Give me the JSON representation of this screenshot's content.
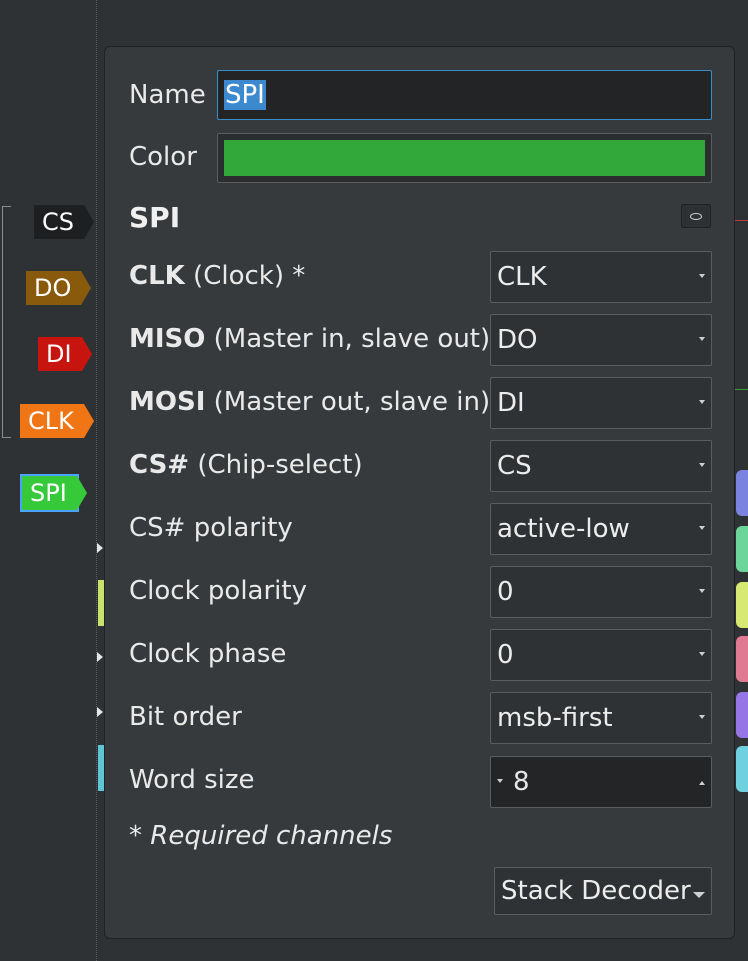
{
  "channels": [
    {
      "label": "CS",
      "color": "#1e1f20"
    },
    {
      "label": "DO",
      "color": "#8a5a0c"
    },
    {
      "label": "DI",
      "color": "#c8140e"
    },
    {
      "label": "CLK",
      "color": "#f07514"
    },
    {
      "label": "SPI",
      "color": "#36c93a"
    }
  ],
  "dialog": {
    "name_label": "Name",
    "name_value": "SPI",
    "color_label": "Color",
    "color_value": "#32a83a",
    "decoder_title": "SPI",
    "collapse_icon": "eye-icon",
    "options": [
      {
        "bold": "CLK",
        "rest": " (Clock) *",
        "value": "CLK"
      },
      {
        "bold": "MISO",
        "rest": " (Master in, slave out)",
        "value": "DO"
      },
      {
        "bold": "MOSI",
        "rest": " (Master out, slave in)",
        "value": "DI"
      },
      {
        "bold": "CS#",
        "rest": " (Chip-select)",
        "value": "CS"
      },
      {
        "bold": "",
        "rest": "CS# polarity",
        "value": "active-low"
      },
      {
        "bold": "",
        "rest": "Clock polarity",
        "value": "0"
      },
      {
        "bold": "",
        "rest": "Clock phase",
        "value": "0"
      },
      {
        "bold": "",
        "rest": "Bit order",
        "value": "msb-first"
      }
    ],
    "word_size_label": "Word size",
    "word_size_value": "8",
    "required_note": "* Required channels",
    "stack_decoder_label": "Stack Decoder"
  }
}
